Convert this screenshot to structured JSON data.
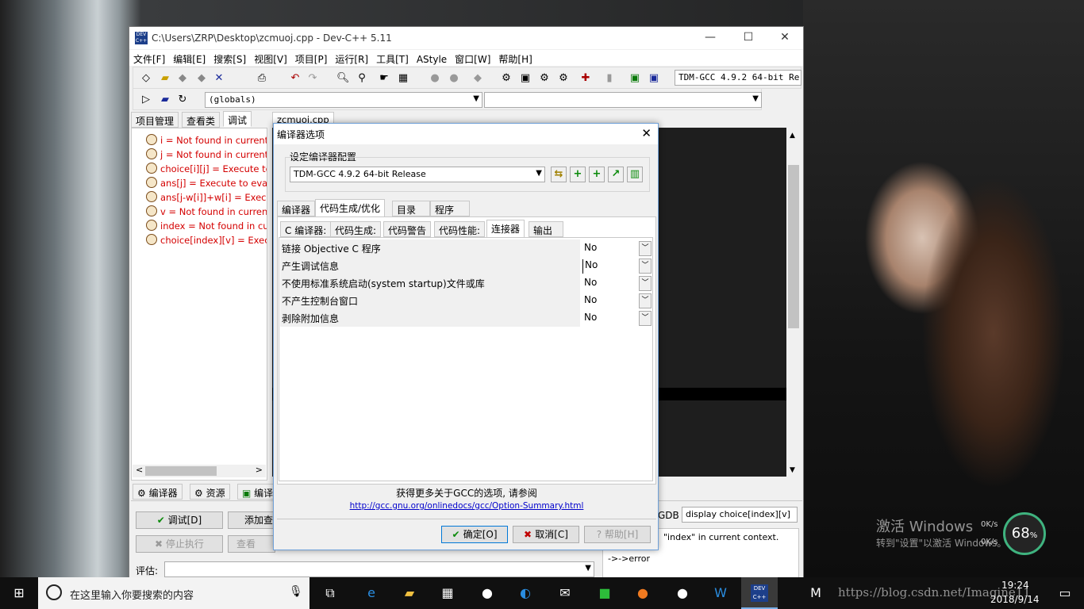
{
  "app": {
    "title": "C:\\Users\\ZRP\\Desktop\\zcmuoj.cpp - Dev-C++ 5.11",
    "icon_label": "DEV C++"
  },
  "menu": [
    "文件[F]",
    "编辑[E]",
    "搜索[S]",
    "视图[V]",
    "项目[P]",
    "运行[R]",
    "工具[T]",
    "AStyle",
    "窗口[W]",
    "帮助[H]"
  ],
  "toolbar": {
    "compiler_select": "TDM-GCC 4.9.2 64-bit Re",
    "globals_select": "(globals)"
  },
  "left_tabs": [
    "项目管理",
    "查看类",
    "调试"
  ],
  "watches": [
    "i = Not found in current",
    "j = Not found in current",
    "choice[i][j] = Execute to",
    "ans[j] = Execute to evalu",
    "ans[j-w[i]]+w[i] = Execu",
    "v = Not found in curren",
    "index = Not found in cu",
    "choice[index][v] = Execu"
  ],
  "editor_tab": "zcmuoj.cpp",
  "bottom_tabs": [
    "编译器",
    "资源",
    "编译"
  ],
  "debug_panel": {
    "debug_btn": "调试[D]",
    "add_watch_btn": "添加查",
    "stop_btn": "停止执行",
    "view_cpu_btn": "查看CPU",
    "eval_label": "评估:",
    "gdb_label": "GDB :",
    "gdb_value": "display choice[index][v]",
    "output_line1": "\"index\" in current context.",
    "output_line2": "->->error"
  },
  "dialog": {
    "title": "编译器选项",
    "group_label": "设定编译器配置",
    "config": "TDM-GCC 4.9.2 64-bit Release",
    "tabs": [
      "编译器",
      "代码生成/优化",
      "目录",
      "程序"
    ],
    "subtabs": [
      "C 编译器:",
      "代码生成:",
      "代码警告",
      "代码性能:",
      "连接器",
      "输出"
    ],
    "rows": [
      {
        "label": "链接 Objective C 程序",
        "value": "No"
      },
      {
        "label": "产生调试信息",
        "value": "No"
      },
      {
        "label": "不使用标准系统启动(system startup)文件或库",
        "value": "No"
      },
      {
        "label": "不产生控制台窗口",
        "value": "No"
      },
      {
        "label": "剥除附加信息",
        "value": "No"
      }
    ],
    "more_info": "获得更多关于GCC的选项, 请参阅",
    "link": "http://gcc.gnu.org/onlinedocs/gcc/Option-Summary.html",
    "ok": "确定[O]",
    "cancel": "取消[C]",
    "help": "帮助[H]"
  },
  "activation": {
    "line1": "激活 Windows",
    "line2": "转到\"设置\"以激活 Windows。"
  },
  "netmeter": {
    "percent": "68",
    "unit": "%",
    "up": "0K/s",
    "down": "0K/s"
  },
  "taskbar": {
    "search_placeholder": "在这里输入你要搜索的内容",
    "time": "19:24",
    "date": "2018/9/14",
    "watermark": "https://blog.csdn.net/Imagine11"
  },
  "colors": {
    "accent": "#0078d7",
    "error_text": "#d40000",
    "link": "#0000cc"
  }
}
